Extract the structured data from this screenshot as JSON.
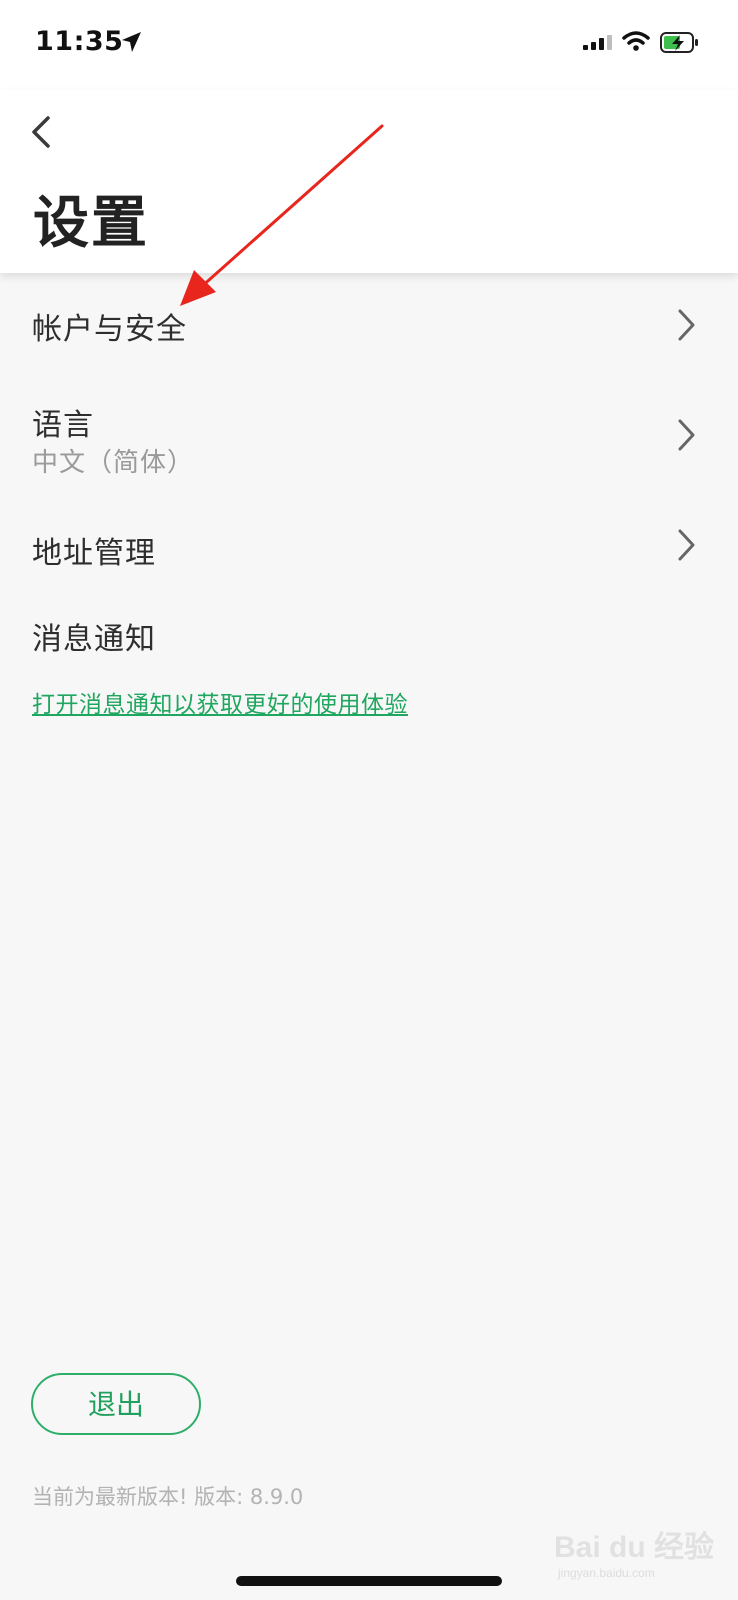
{
  "status_bar": {
    "time": "11:35",
    "icons": [
      "location-arrow-icon",
      "cellular-signal-icon",
      "wifi-icon",
      "battery-charging-icon"
    ]
  },
  "header": {
    "back_icon": "chevron-left-icon",
    "title": "设置"
  },
  "settings": {
    "items": [
      {
        "label": "帐户与安全",
        "icon": "chevron-right-icon"
      },
      {
        "label": "语言",
        "value": "中文（简体）",
        "icon": "chevron-right-icon"
      },
      {
        "label": "地址管理",
        "icon": "chevron-right-icon"
      },
      {
        "label": "消息通知",
        "link": "打开消息通知以获取更好的使用体验"
      }
    ]
  },
  "footer": {
    "logout_label": "退出",
    "version_text": "当前为最新版本! 版本: 8.9.0"
  },
  "watermark": {
    "text": "Bai du 经验",
    "url": "jingyan.baidu.com"
  },
  "colors": {
    "accent_green": "#1fa65f",
    "annotation_arrow": "#e8261e",
    "background": "#f7f7f7"
  }
}
